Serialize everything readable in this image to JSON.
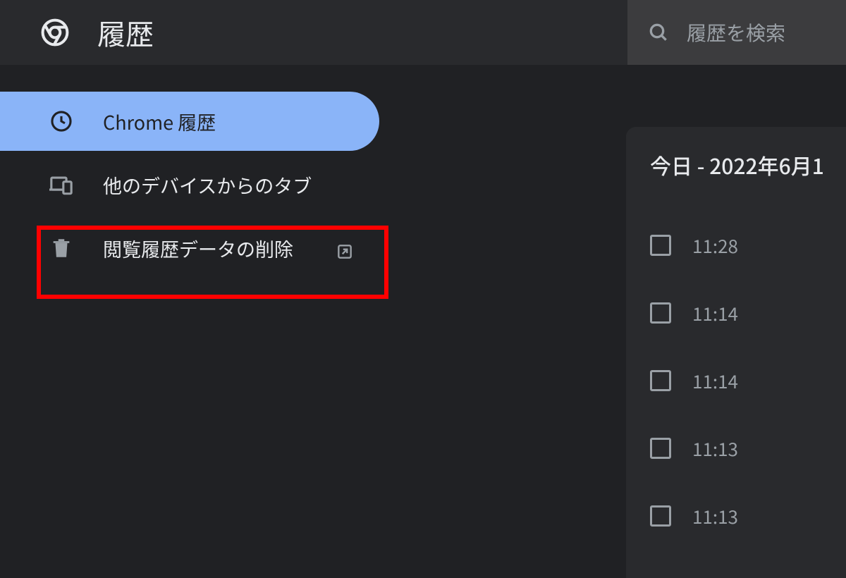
{
  "header": {
    "title": "履歴",
    "search_placeholder": "履歴を検索"
  },
  "sidebar": {
    "items": [
      {
        "label": "Chrome 履歴",
        "active": true
      },
      {
        "label": "他のデバイスからのタブ",
        "active": false
      },
      {
        "label": "閲覧履歴データの削除",
        "active": false,
        "external": true
      }
    ]
  },
  "history": {
    "date_label": "今日 - 2022年6月1",
    "entries": [
      {
        "time": "11:28"
      },
      {
        "time": "11:14"
      },
      {
        "time": "11:14"
      },
      {
        "time": "11:13"
      },
      {
        "time": "11:13"
      }
    ]
  }
}
